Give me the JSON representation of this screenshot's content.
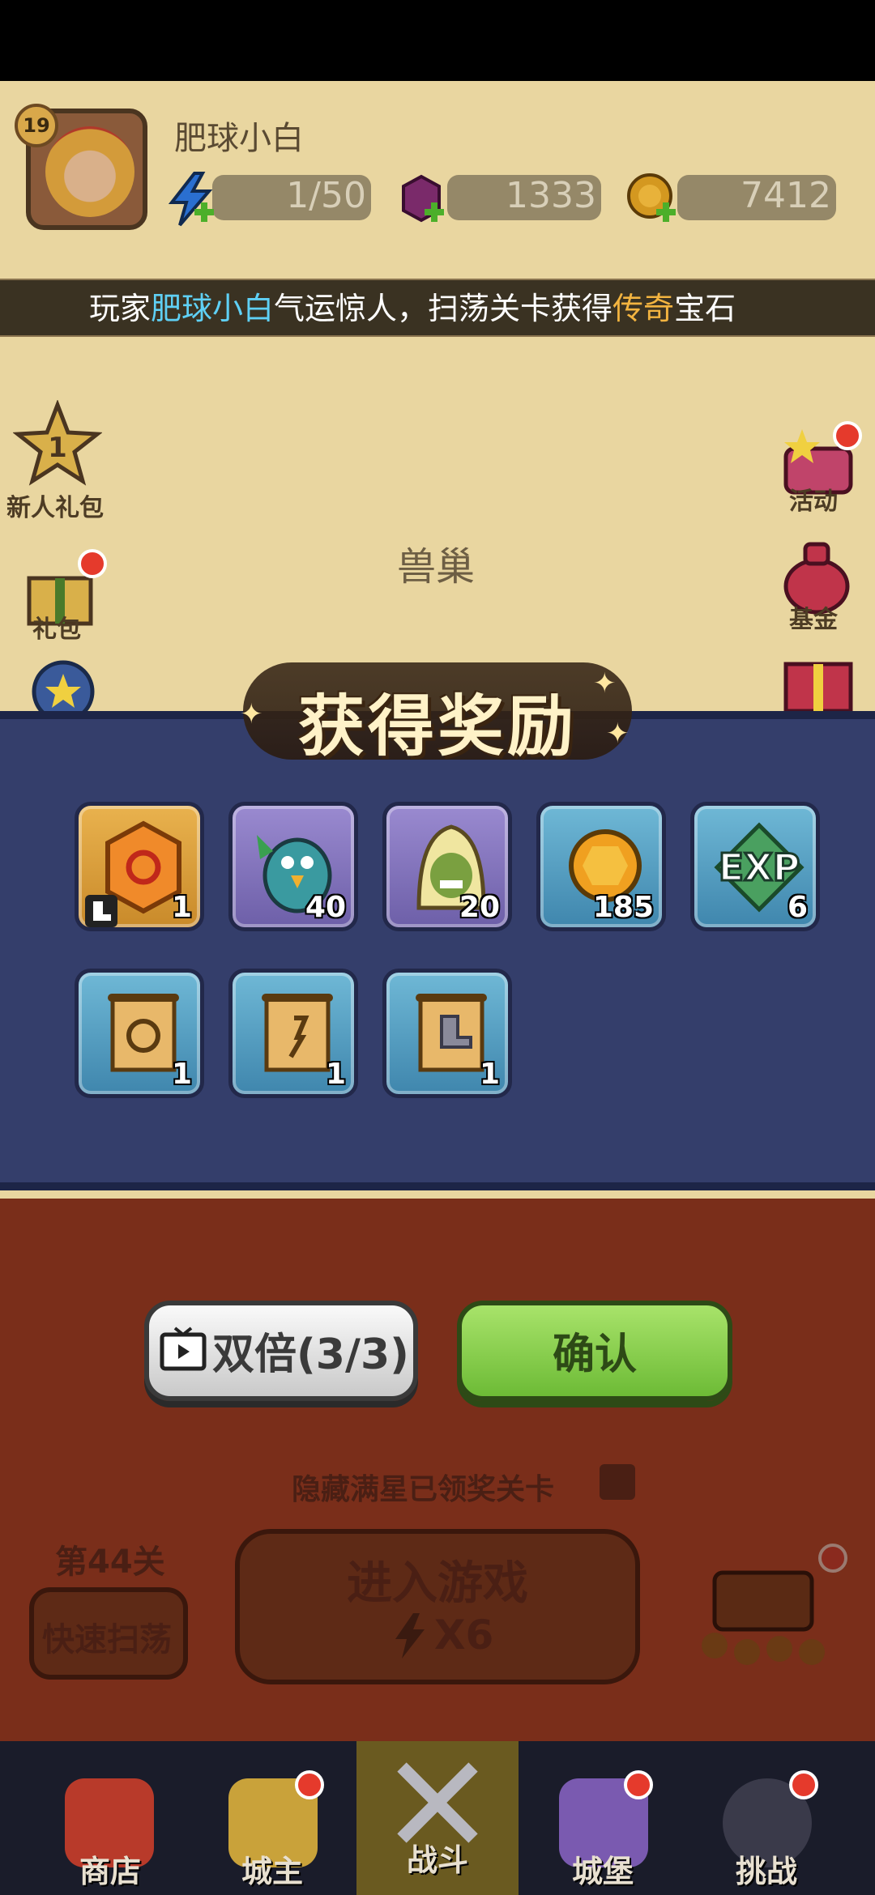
{
  "player": {
    "level": "19",
    "name": "肥球小白"
  },
  "resources": [
    {
      "name": "energy",
      "value": "1/50",
      "icon": "lightning-icon"
    },
    {
      "name": "gems",
      "value": "1333",
      "icon": "gem-icon"
    },
    {
      "name": "coins",
      "value": "7412",
      "icon": "coin-icon"
    }
  ],
  "marquee": {
    "prefix": "玩家",
    "player": "肥球小白",
    "middle": "气运惊人，扫荡关卡获得",
    "item": "传奇",
    "suffix": "宝石"
  },
  "left_side": [
    {
      "label": "新人礼包",
      "badge": "1"
    },
    {
      "label": "礼包"
    }
  ],
  "right_side": [
    {
      "label": "活动"
    },
    {
      "label": "基金"
    }
  ],
  "stage": {
    "name": "兽巢"
  },
  "reward": {
    "title": "获得奖励",
    "items": [
      {
        "name": "gem",
        "qty": "1",
        "icon": "orange-gem-icon"
      },
      {
        "name": "hero-shard-bird",
        "qty": "40",
        "icon": "bird-hero-icon"
      },
      {
        "name": "hero-shard-hood",
        "qty": "20",
        "icon": "hooded-hero-icon"
      },
      {
        "name": "coin",
        "qty": "185",
        "icon": "gold-coin-icon"
      },
      {
        "name": "exp",
        "qty": "6",
        "label": "EXP",
        "icon": "exp-icon"
      },
      {
        "name": "ring-scroll",
        "qty": "1",
        "icon": "ring-scroll-icon"
      },
      {
        "name": "staff-scroll",
        "qty": "1",
        "icon": "staff-scroll-icon"
      },
      {
        "name": "boot-scroll",
        "qty": "1",
        "icon": "boot-scroll-icon"
      }
    ]
  },
  "buttons": {
    "double": "双倍(3/3)",
    "confirm": "确认"
  },
  "lower": {
    "hidden_text": "隐藏满星已领奖关卡",
    "level_label": "第44关",
    "sweep": "快速扫荡",
    "enter": "进入游戏",
    "cost": "X6"
  },
  "nav": [
    {
      "label": "商店"
    },
    {
      "label": "城主"
    },
    {
      "label": "战斗"
    },
    {
      "label": "城堡"
    },
    {
      "label": "挑战"
    }
  ]
}
